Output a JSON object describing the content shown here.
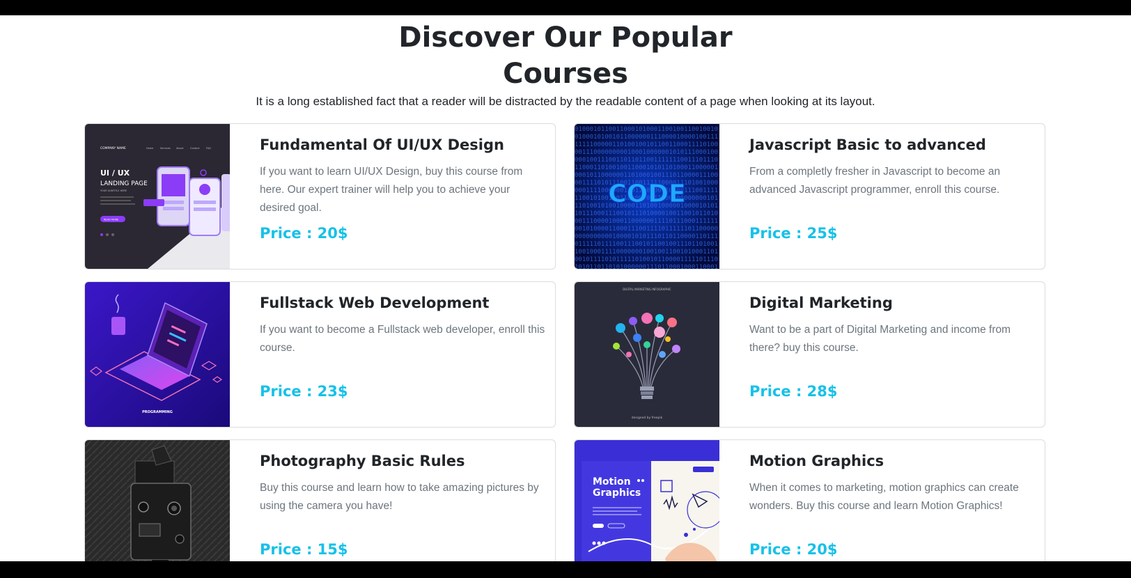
{
  "section": {
    "title_line1": "Discover Our Popular",
    "title_line2": "Courses",
    "subtitle": "It is a long established fact that a reader will be distracted by the readable content of a page when looking at its layout."
  },
  "courses": [
    {
      "title": "Fundamental Of UI/UX Design",
      "description": "If you want to learn UI/UX Design, buy this course from here. Our expert trainer will help you to achieve your desired goal.",
      "price": "Price : 20$",
      "image": "ui-ux-landing-page-illustration",
      "thumb_text": {
        "company": "COMPANY NAME",
        "nav": [
          "Home",
          "Services",
          "About",
          "Contact",
          "FAQ"
        ],
        "headline": "UI / UX",
        "subheadline": "LANDING PAGE",
        "tagline": "YOUR SUBTITLE HERE",
        "button": "READ MORE"
      }
    },
    {
      "title": "Javascript Basic to advanced",
      "description": "From a completly fresher in Javascript to become an advanced Javascript programmer, enroll this course.",
      "price": "Price : 25$",
      "image": "code-binary-illustration",
      "thumb_text": {
        "word": "CODE"
      }
    },
    {
      "title": "Fullstack Web Development",
      "description": "If you want to become a Fullstack web developer, enroll this course.",
      "price": "Price : 23$",
      "image": "isometric-laptop-illustration",
      "thumb_text": {
        "caption": "PROGRAMMING"
      }
    },
    {
      "title": "Digital Marketing",
      "description": "Want to be a part of Digital Marketing and income from there? buy this course.",
      "price": "Price : 28$",
      "image": "lightbulb-infographic-illustration",
      "thumb_text": {
        "caption": "DIGITAL MARKETING INFOGRAPHIC",
        "credit": "designed by freepik"
      }
    },
    {
      "title": "Photography Basic Rules",
      "description": "Buy this course and learn how to take amazing pictures by using the camera you have!",
      "price": "Price : 15$",
      "image": "vintage-camera-photo",
      "thumb_text": {}
    },
    {
      "title": "Motion Graphics",
      "description": "When it comes to marketing, motion graphics can create wonders. Buy this course and learn Motion Graphics!",
      "price": "Price : 20$",
      "image": "motion-graphics-illustration",
      "thumb_text": {
        "headline_line1": "Motion",
        "headline_line2": "Graphics"
      }
    }
  ],
  "colors": {
    "price": "#17c1e8",
    "heading": "#212529",
    "description": "#6c757d",
    "card_border": "#dcdcdc"
  }
}
